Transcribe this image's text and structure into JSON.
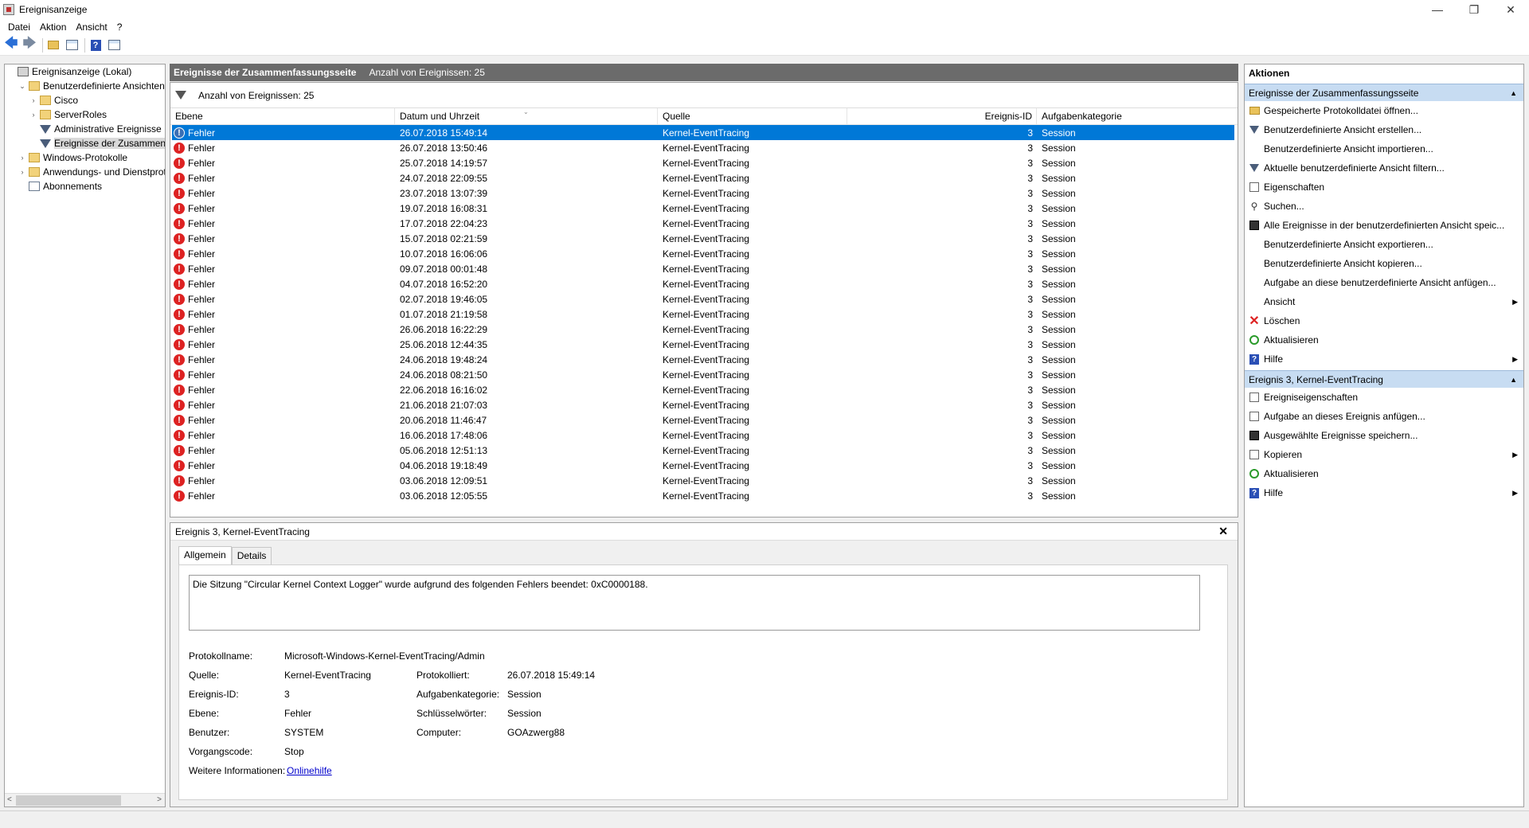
{
  "window": {
    "title": "Ereignisanzeige",
    "minimize": "—",
    "restore": "❐",
    "close": "✕"
  },
  "menu": [
    "Datei",
    "Aktion",
    "Ansicht",
    "?"
  ],
  "tree": {
    "items": [
      {
        "label": "Ereignisanzeige (Lokal)",
        "indent": 0,
        "expander": "",
        "icon": "root"
      },
      {
        "label": "Benutzerdefinierte Ansichten",
        "indent": 1,
        "expander": "⌄",
        "icon": "folder"
      },
      {
        "label": "Cisco",
        "indent": 2,
        "expander": "›",
        "icon": "folder"
      },
      {
        "label": "ServerRoles",
        "indent": 2,
        "expander": "›",
        "icon": "folder"
      },
      {
        "label": "Administrative Ereignisse",
        "indent": 2,
        "expander": "",
        "icon": "filter"
      },
      {
        "label": "Ereignisse der Zusammenf",
        "indent": 2,
        "expander": "",
        "icon": "filter"
      },
      {
        "label": "Windows-Protokolle",
        "indent": 1,
        "expander": "›",
        "icon": "folder"
      },
      {
        "label": "Anwendungs- und Dienstprot",
        "indent": 1,
        "expander": "›",
        "icon": "folder"
      },
      {
        "label": "Abonnements",
        "indent": 1,
        "expander": "",
        "icon": "log"
      }
    ],
    "scroll_left": "<",
    "scroll_right": ">"
  },
  "center": {
    "header_title": "Ereignisse der Zusammenfassungsseite",
    "header_count": "Anzahl von Ereignissen: 25",
    "filter_text": "Anzahl von Ereignissen: 25",
    "columns": [
      "Ebene",
      "Datum und Uhrzeit",
      "Quelle",
      "Ereignis-ID",
      "Aufgabenkategorie"
    ],
    "rows": [
      {
        "level": "Fehler",
        "date": "26.07.2018 15:49:14",
        "source": "Kernel-EventTracing",
        "id": "3",
        "category": "Session"
      },
      {
        "level": "Fehler",
        "date": "26.07.2018 13:50:46",
        "source": "Kernel-EventTracing",
        "id": "3",
        "category": "Session"
      },
      {
        "level": "Fehler",
        "date": "25.07.2018 14:19:57",
        "source": "Kernel-EventTracing",
        "id": "3",
        "category": "Session"
      },
      {
        "level": "Fehler",
        "date": "24.07.2018 22:09:55",
        "source": "Kernel-EventTracing",
        "id": "3",
        "category": "Session"
      },
      {
        "level": "Fehler",
        "date": "23.07.2018 13:07:39",
        "source": "Kernel-EventTracing",
        "id": "3",
        "category": "Session"
      },
      {
        "level": "Fehler",
        "date": "19.07.2018 16:08:31",
        "source": "Kernel-EventTracing",
        "id": "3",
        "category": "Session"
      },
      {
        "level": "Fehler",
        "date": "17.07.2018 22:04:23",
        "source": "Kernel-EventTracing",
        "id": "3",
        "category": "Session"
      },
      {
        "level": "Fehler",
        "date": "15.07.2018 02:21:59",
        "source": "Kernel-EventTracing",
        "id": "3",
        "category": "Session"
      },
      {
        "level": "Fehler",
        "date": "10.07.2018 16:06:06",
        "source": "Kernel-EventTracing",
        "id": "3",
        "category": "Session"
      },
      {
        "level": "Fehler",
        "date": "09.07.2018 00:01:48",
        "source": "Kernel-EventTracing",
        "id": "3",
        "category": "Session"
      },
      {
        "level": "Fehler",
        "date": "04.07.2018 16:52:20",
        "source": "Kernel-EventTracing",
        "id": "3",
        "category": "Session"
      },
      {
        "level": "Fehler",
        "date": "02.07.2018 19:46:05",
        "source": "Kernel-EventTracing",
        "id": "3",
        "category": "Session"
      },
      {
        "level": "Fehler",
        "date": "01.07.2018 21:19:58",
        "source": "Kernel-EventTracing",
        "id": "3",
        "category": "Session"
      },
      {
        "level": "Fehler",
        "date": "26.06.2018 16:22:29",
        "source": "Kernel-EventTracing",
        "id": "3",
        "category": "Session"
      },
      {
        "level": "Fehler",
        "date": "25.06.2018 12:44:35",
        "source": "Kernel-EventTracing",
        "id": "3",
        "category": "Session"
      },
      {
        "level": "Fehler",
        "date": "24.06.2018 19:48:24",
        "source": "Kernel-EventTracing",
        "id": "3",
        "category": "Session"
      },
      {
        "level": "Fehler",
        "date": "24.06.2018 08:21:50",
        "source": "Kernel-EventTracing",
        "id": "3",
        "category": "Session"
      },
      {
        "level": "Fehler",
        "date": "22.06.2018 16:16:02",
        "source": "Kernel-EventTracing",
        "id": "3",
        "category": "Session"
      },
      {
        "level": "Fehler",
        "date": "21.06.2018 21:07:03",
        "source": "Kernel-EventTracing",
        "id": "3",
        "category": "Session"
      },
      {
        "level": "Fehler",
        "date": "20.06.2018 11:46:47",
        "source": "Kernel-EventTracing",
        "id": "3",
        "category": "Session"
      },
      {
        "level": "Fehler",
        "date": "16.06.2018 17:48:06",
        "source": "Kernel-EventTracing",
        "id": "3",
        "category": "Session"
      },
      {
        "level": "Fehler",
        "date": "05.06.2018 12:51:13",
        "source": "Kernel-EventTracing",
        "id": "3",
        "category": "Session"
      },
      {
        "level": "Fehler",
        "date": "04.06.2018 19:18:49",
        "source": "Kernel-EventTracing",
        "id": "3",
        "category": "Session"
      },
      {
        "level": "Fehler",
        "date": "03.06.2018 12:09:51",
        "source": "Kernel-EventTracing",
        "id": "3",
        "category": "Session"
      },
      {
        "level": "Fehler",
        "date": "03.06.2018 12:05:55",
        "source": "Kernel-EventTracing",
        "id": "3",
        "category": "Session"
      }
    ],
    "selected_index": 0
  },
  "details": {
    "title": "Ereignis 3, Kernel-EventTracing",
    "tabs": [
      "Allgemein",
      "Details"
    ],
    "message": "Die Sitzung \"Circular Kernel Context Logger\" wurde aufgrund des folgenden Fehlers beendet: 0xC0000188.",
    "labels": {
      "log_name": "Protokollname:",
      "source": "Quelle:",
      "event_id": "Ereignis-ID:",
      "level": "Ebene:",
      "user": "Benutzer:",
      "opcode": "Vorgangscode:",
      "more_info": "Weitere Informationen:",
      "logged": "Protokolliert:",
      "task_category": "Aufgabenkategorie:",
      "keywords": "Schlüsselwörter:",
      "computer": "Computer:"
    },
    "values": {
      "log_name": "Microsoft-Windows-Kernel-EventTracing/Admin",
      "source": "Kernel-EventTracing",
      "event_id": "3",
      "level": "Fehler",
      "user": "SYSTEM",
      "opcode": "Stop",
      "more_info": "Onlinehilfe",
      "logged": "26.07.2018 15:49:14",
      "task_category": "Session",
      "keywords": "Session",
      "computer": "GOAzwerg88"
    }
  },
  "actions": {
    "header": "Aktionen",
    "section1": "Ereignisse der Zusammenfassungsseite",
    "items1": [
      {
        "label": "Gespeicherte Protokolldatei öffnen...",
        "icon": "folder",
        "sub": false
      },
      {
        "label": "Benutzerdefinierte Ansicht erstellen...",
        "icon": "filter",
        "sub": false
      },
      {
        "label": "Benutzerdefinierte Ansicht importieren...",
        "icon": "",
        "sub": false
      },
      {
        "label": "Aktuelle benutzerdefinierte Ansicht filtern...",
        "icon": "filter",
        "sub": false
      },
      {
        "label": "Eigenschaften",
        "icon": "props",
        "sub": false
      },
      {
        "label": "Suchen...",
        "icon": "find",
        "sub": false
      },
      {
        "label": "Alle Ereignisse in der benutzerdefinierten Ansicht speic...",
        "icon": "save",
        "sub": false
      },
      {
        "label": "Benutzerdefinierte Ansicht exportieren...",
        "icon": "",
        "sub": false
      },
      {
        "label": "Benutzerdefinierte Ansicht kopieren...",
        "icon": "",
        "sub": false
      },
      {
        "label": "Aufgabe an diese benutzerdefinierte Ansicht anfügen...",
        "icon": "",
        "sub": false
      },
      {
        "label": "Ansicht",
        "icon": "",
        "sub": true
      },
      {
        "label": "Löschen",
        "icon": "delete",
        "sub": false
      },
      {
        "label": "Aktualisieren",
        "icon": "refresh",
        "sub": false
      },
      {
        "label": "Hilfe",
        "icon": "help",
        "sub": true
      }
    ],
    "section2": "Ereignis 3, Kernel-EventTracing",
    "items2": [
      {
        "label": "Ereigniseigenschaften",
        "icon": "props",
        "sub": false
      },
      {
        "label": "Aufgabe an dieses Ereignis anfügen...",
        "icon": "props",
        "sub": false
      },
      {
        "label": "Ausgewählte Ereignisse speichern...",
        "icon": "save",
        "sub": false
      },
      {
        "label": "Kopieren",
        "icon": "props",
        "sub": true
      },
      {
        "label": "Aktualisieren",
        "icon": "refresh",
        "sub": false
      },
      {
        "label": "Hilfe",
        "icon": "help",
        "sub": true
      }
    ]
  }
}
